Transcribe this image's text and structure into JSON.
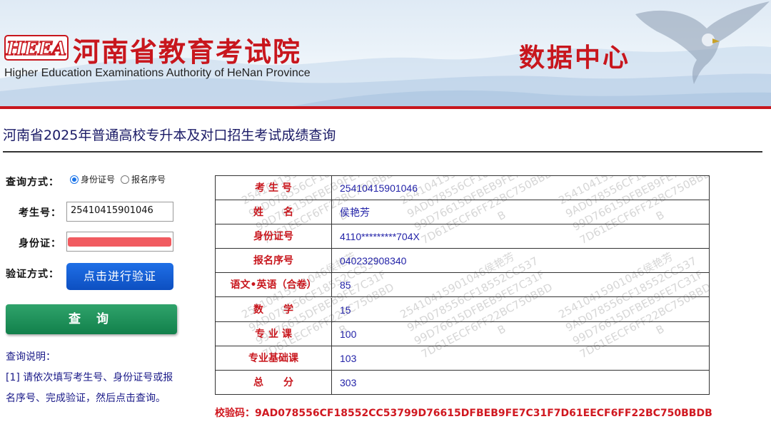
{
  "header": {
    "logo_text": "HEEA",
    "org_name": "河南省教育考试院",
    "org_name_en": "Higher Education Examinations Authority of HeNan Province",
    "center_name": "数据中心"
  },
  "page_title": "河南省2025年普通高校专升本及对口招生考试成绩查询",
  "form": {
    "query_mode_label": "查询方式：",
    "radio_options": [
      "身份证号",
      "报名序号"
    ],
    "selected_option": "身份证号",
    "exam_no_label": "考生号：",
    "exam_no_value": "25410415901046",
    "id_label": "身份证：",
    "verify_label": "验证方式：",
    "verify_button": "点击进行验证",
    "query_button": "查 询"
  },
  "instructions": {
    "title": "查询说明：",
    "text": "[1] 请依次填写考生号、身份证号或报名序号、完成验证，然后点击查询。"
  },
  "result": {
    "rows": [
      {
        "key": "考 生 号",
        "value": "25410415901046"
      },
      {
        "key": "姓　　名",
        "value": "侯艳芳"
      },
      {
        "key": "身份证号",
        "value": "4110*********704X"
      },
      {
        "key": "报名序号",
        "value": "040232908340"
      },
      {
        "key": "语文•英语（合卷）",
        "value": "85"
      },
      {
        "key": "数　　学",
        "value": "15"
      },
      {
        "key": "专 业 课",
        "value": "100"
      },
      {
        "key": "专业基础课",
        "value": "103"
      },
      {
        "key": "总　　分",
        "value": "303"
      }
    ],
    "watermark_lines": [
      "25410415901046侯艳芳",
      "9AD078556CF18552CC537",
      "99D76615DFBEB9FE7C31F",
      "7D61EECF6FF22BC750BBD",
      "B"
    ]
  },
  "checksum": {
    "label": "校验码：",
    "value": "9AD078556CF18552CC53799D76615DFBEB9FE7C31F7D61EECF6FF22BC750BBDB"
  },
  "colors": {
    "brand_red": "#c8161d",
    "text_blue": "#2323a8",
    "verify_blue": "#1565e0",
    "query_green": "#1a8f56"
  }
}
